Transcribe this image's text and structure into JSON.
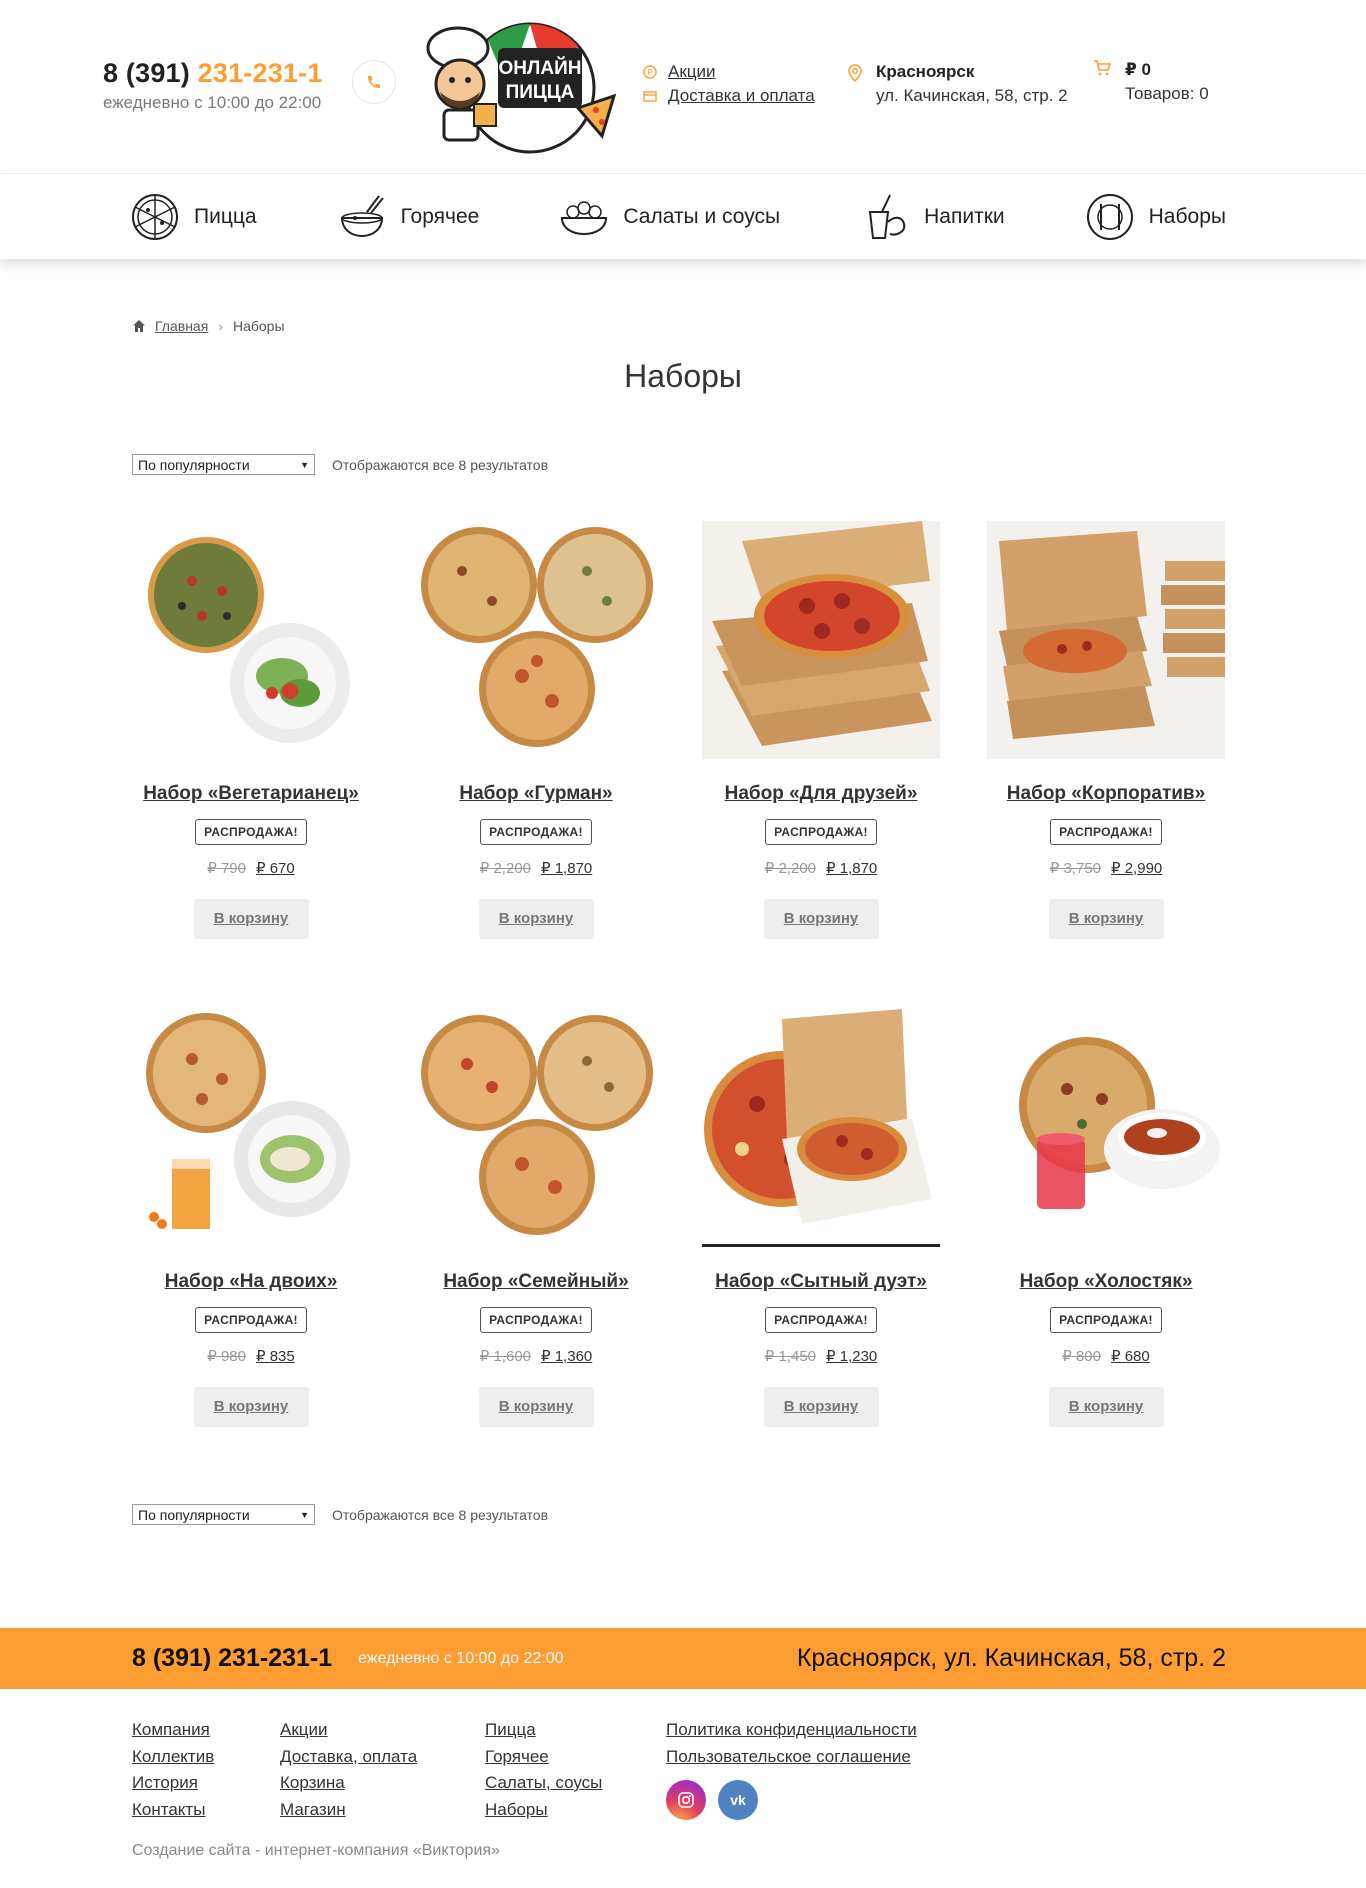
{
  "header": {
    "phone_prefix": "8 (391) ",
    "phone_main": "231-231-1",
    "hours": "ежедневно с 10:00 до 22:00",
    "logo_text_line1": "ОНЛАЙН",
    "logo_text_line2": "ПИЦЦА",
    "links": [
      {
        "label": "Акции",
        "icon": "promo-icon"
      },
      {
        "label": "Доставка и оплата",
        "icon": "box-icon"
      }
    ],
    "city": "Красноярск",
    "address": "ул. Качинская, 58, стр. 2",
    "cart_total": "₽ 0",
    "cart_count": "Товаров: 0"
  },
  "nav": [
    {
      "label": "Пицца",
      "icon": "pizza-icon"
    },
    {
      "label": "Горячее",
      "icon": "soup-bowl-icon"
    },
    {
      "label": "Салаты и соусы",
      "icon": "salad-icon"
    },
    {
      "label": "Напитки",
      "icon": "drinks-icon"
    },
    {
      "label": "Наборы",
      "icon": "plate-cutlery-icon"
    }
  ],
  "breadcrumb": {
    "home": "Главная",
    "current": "Наборы"
  },
  "page_title": "Наборы",
  "sorting": {
    "selected": "По популярности",
    "result_count": "Отображаются все 8 результатов"
  },
  "products": [
    {
      "name": "Набор «Вегетарианец»",
      "badge": "РАСПРОДАЖА!",
      "old_price": "₽ 790",
      "new_price": "₽ 670",
      "button": "В корзину"
    },
    {
      "name": "Набор «Гурман»",
      "badge": "РАСПРОДАЖА!",
      "old_price": "₽ 2,200",
      "new_price": "₽ 1,870",
      "button": "В корзину"
    },
    {
      "name": "Набор «Для друзей»",
      "badge": "РАСПРОДАЖА!",
      "old_price": "₽ 2,200",
      "new_price": "₽ 1,870",
      "button": "В корзину"
    },
    {
      "name": "Набор «Корпоратив»",
      "badge": "РАСПРОДАЖА!",
      "old_price": "₽ 3,750",
      "new_price": "₽ 2,990",
      "button": "В корзину"
    },
    {
      "name": "Набор «На двоих»",
      "badge": "РАСПРОДАЖА!",
      "old_price": "₽ 980",
      "new_price": "₽ 835",
      "button": "В корзину"
    },
    {
      "name": "Набор «Семейный»",
      "badge": "РАСПРОДАЖА!",
      "old_price": "₽ 1,600",
      "new_price": "₽ 1,360",
      "button": "В корзину"
    },
    {
      "name": "Набор «Сытный дуэт»",
      "badge": "РАСПРОДАЖА!",
      "old_price": "₽ 1,450",
      "new_price": "₽ 1,230",
      "button": "В корзину"
    },
    {
      "name": "Набор «Холостяк»",
      "badge": "РАСПРОДАЖА!",
      "old_price": "₽ 800",
      "new_price": "₽ 680",
      "button": "В корзину"
    }
  ],
  "footer": {
    "phone": "8 (391) 231-231-1",
    "hours": "ежедневно с 10:00 до 22:00",
    "address": "Красноярск, ул. Качинская, 58, стр. 2",
    "col1": [
      "Компания",
      "Коллектив",
      "История",
      "Контакты"
    ],
    "col2": [
      "Акции",
      "Доставка, оплата",
      "Корзина",
      "Магазин"
    ],
    "col3": [
      "Пицца",
      "Горячее",
      "Салаты, соусы",
      "Наборы"
    ],
    "col4": [
      "Политика конфиденциальности",
      "Пользовательское соглашение"
    ],
    "socials": [
      {
        "icon": "instagram-icon"
      },
      {
        "icon": "vk-icon",
        "label": "vk"
      }
    ],
    "copyright": "Создание сайта - интернет-компания «Виктория»"
  },
  "colors": {
    "accent": "#ff9c32",
    "text": "#222222",
    "muted": "#7a7a7a"
  }
}
